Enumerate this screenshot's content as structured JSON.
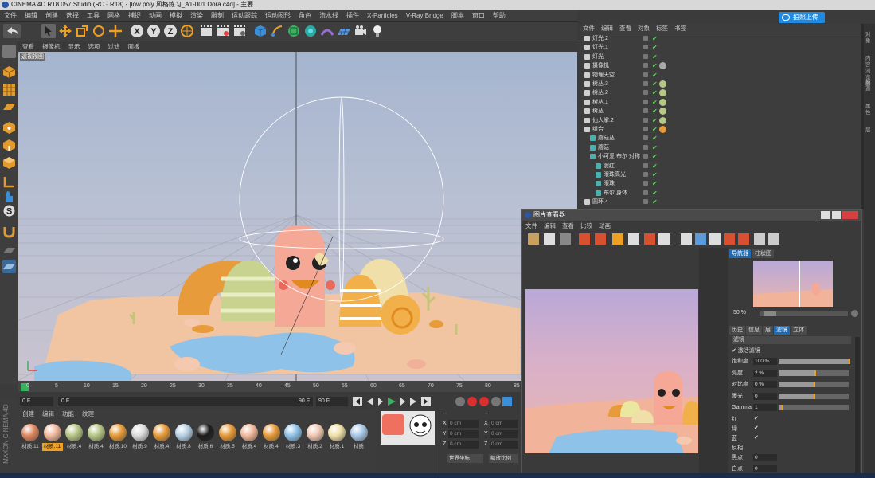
{
  "window": {
    "title": "CINEMA 4D R18.057 Studio (RC - R18) - [low poly 风格练习_A1-001 Dora.c4d] - 主要"
  },
  "menubar": [
    "文件",
    "编辑",
    "创建",
    "选择",
    "工具",
    "网格",
    "捕捉",
    "动画",
    "模拟",
    "渲染",
    "雕刻",
    "运动跟踪",
    "运动图形",
    "角色",
    "流水线",
    "插件",
    "X-Particles",
    "V-Ray Bridge",
    "脚本",
    "窗口",
    "帮助"
  ],
  "upload_button": "拍照上传",
  "viewport": {
    "menu": [
      "查看",
      "摄像机",
      "显示",
      "选项",
      "过滤",
      "面板"
    ],
    "label": "透视视图"
  },
  "timeline": {
    "ticks": [
      "0",
      "5",
      "10",
      "15",
      "20",
      "25",
      "30",
      "35",
      "40",
      "45",
      "50",
      "55",
      "60",
      "65",
      "70",
      "75",
      "80",
      "85"
    ],
    "start_frame": "0 F",
    "current_frame": "0 F",
    "end_frame": "90 F",
    "end_frame_b": "90 F"
  },
  "materials": {
    "menu": [
      "创建",
      "编辑",
      "功能",
      "纹理"
    ],
    "items": [
      {
        "label": "材质.11",
        "color": "#e08860"
      },
      {
        "label": "材质.11",
        "color": "#f2b89b",
        "selected": true
      },
      {
        "label": "材质.4",
        "color": "#b6c685"
      },
      {
        "label": "材质.4",
        "color": "#b6c685"
      },
      {
        "label": "材质.10",
        "color": "#e79b3a"
      },
      {
        "label": "材质.9",
        "color": "#dcdcdc"
      },
      {
        "label": "材质.4",
        "color": "#e79b3a"
      },
      {
        "label": "材质.8",
        "color": "#b8d1e6"
      },
      {
        "label": "材质.6",
        "color": "#1c1c1c"
      },
      {
        "label": "材质.5",
        "color": "#e79b3a"
      },
      {
        "label": "材质.4",
        "color": "#f2b89b"
      },
      {
        "label": "材质.4",
        "color": "#e79b3a"
      },
      {
        "label": "材质.3",
        "color": "#8fc2e8"
      },
      {
        "label": "材质.2",
        "color": "#f0c8b2"
      },
      {
        "label": "材质.1",
        "color": "#f0e0a8"
      },
      {
        "label": "材质",
        "color": "#a8c8e8"
      }
    ]
  },
  "coords": {
    "header": "--",
    "rows": [
      {
        "a": "X",
        "v1": "0 cm",
        "b": "X",
        "v2": "0 cm"
      },
      {
        "a": "Y",
        "v1": "0 cm",
        "b": "Y",
        "v2": "0 cm"
      },
      {
        "a": "Z",
        "v1": "0 cm",
        "b": "Z",
        "v2": "0 cm"
      }
    ],
    "mode": "世界坐标",
    "apply": "缩放比例"
  },
  "objects": {
    "menu": [
      "文件",
      "编辑",
      "查看",
      "对象",
      "标签",
      "书签"
    ],
    "rows": [
      {
        "name": "灯光.2",
        "indent": 0,
        "tag": ""
      },
      {
        "name": "灯光.1",
        "indent": 0,
        "tag": ""
      },
      {
        "name": "灯光",
        "indent": 0,
        "tag": ""
      },
      {
        "name": "摄像机",
        "indent": 0,
        "tag": "#aaaaaa"
      },
      {
        "name": "物理天空",
        "indent": 0,
        "tag": ""
      },
      {
        "name": "树丛.3",
        "indent": 0,
        "tag": "#b6c685"
      },
      {
        "name": "树丛.2",
        "indent": 0,
        "tag": "#b6c685"
      },
      {
        "name": "树丛.1",
        "indent": 0,
        "tag": "#b6c685"
      },
      {
        "name": "树丛",
        "indent": 0,
        "tag": "#b6c685"
      },
      {
        "name": "仙人掌.2",
        "indent": 0,
        "tag": "#b6c685"
      },
      {
        "name": "组合",
        "indent": 0,
        "tag": "#e79b3a"
      },
      {
        "name": "蘑菇丛",
        "indent": 1,
        "tag": ""
      },
      {
        "name": "蘑菇",
        "indent": 1,
        "tag": ""
      },
      {
        "name": "小可爱 布尔 对称",
        "indent": 1,
        "tag": ""
      },
      {
        "name": "腮红",
        "indent": 2,
        "tag": ""
      },
      {
        "name": "眼珠高光",
        "indent": 2,
        "tag": ""
      },
      {
        "name": "眼珠",
        "indent": 2,
        "tag": ""
      },
      {
        "name": "布尔 身体",
        "indent": 2,
        "tag": ""
      },
      {
        "name": "圆环.4",
        "indent": 0,
        "tag": ""
      }
    ]
  },
  "picture_viewer": {
    "title": "图片查看器",
    "menu": [
      "文件",
      "编辑",
      "查看",
      "比较",
      "动画"
    ],
    "nav_tabs": [
      "导航器",
      "柱状图"
    ],
    "zoom": "50 %",
    "tabs": [
      "历史",
      "信息",
      "层",
      "滤镜",
      "立体"
    ],
    "section": "滤镜",
    "activate_filter": "激活滤镜",
    "sliders": [
      {
        "label": "饱和度",
        "value": "100 %",
        "fill": 1.0
      },
      {
        "label": "亮度",
        "value": "2 %",
        "fill": 0.51
      },
      {
        "label": "对比度",
        "value": "0 %",
        "fill": 0.5
      },
      {
        "label": "曝光",
        "value": "0",
        "fill": 0.5
      },
      {
        "label": "Gamma",
        "value": "1",
        "fill": 0.05
      }
    ],
    "checks": [
      {
        "label": "红"
      },
      {
        "label": "绿"
      },
      {
        "label": "蓝"
      }
    ],
    "invert_label": "反相",
    "black_label": "黑点",
    "black_value": "0",
    "white_label": "白点",
    "white_value": "0"
  },
  "right_strip": [
    "对象",
    "内容浏览器",
    "构造",
    "属性",
    "层"
  ],
  "brand": "MAXON CINEMA 4D"
}
